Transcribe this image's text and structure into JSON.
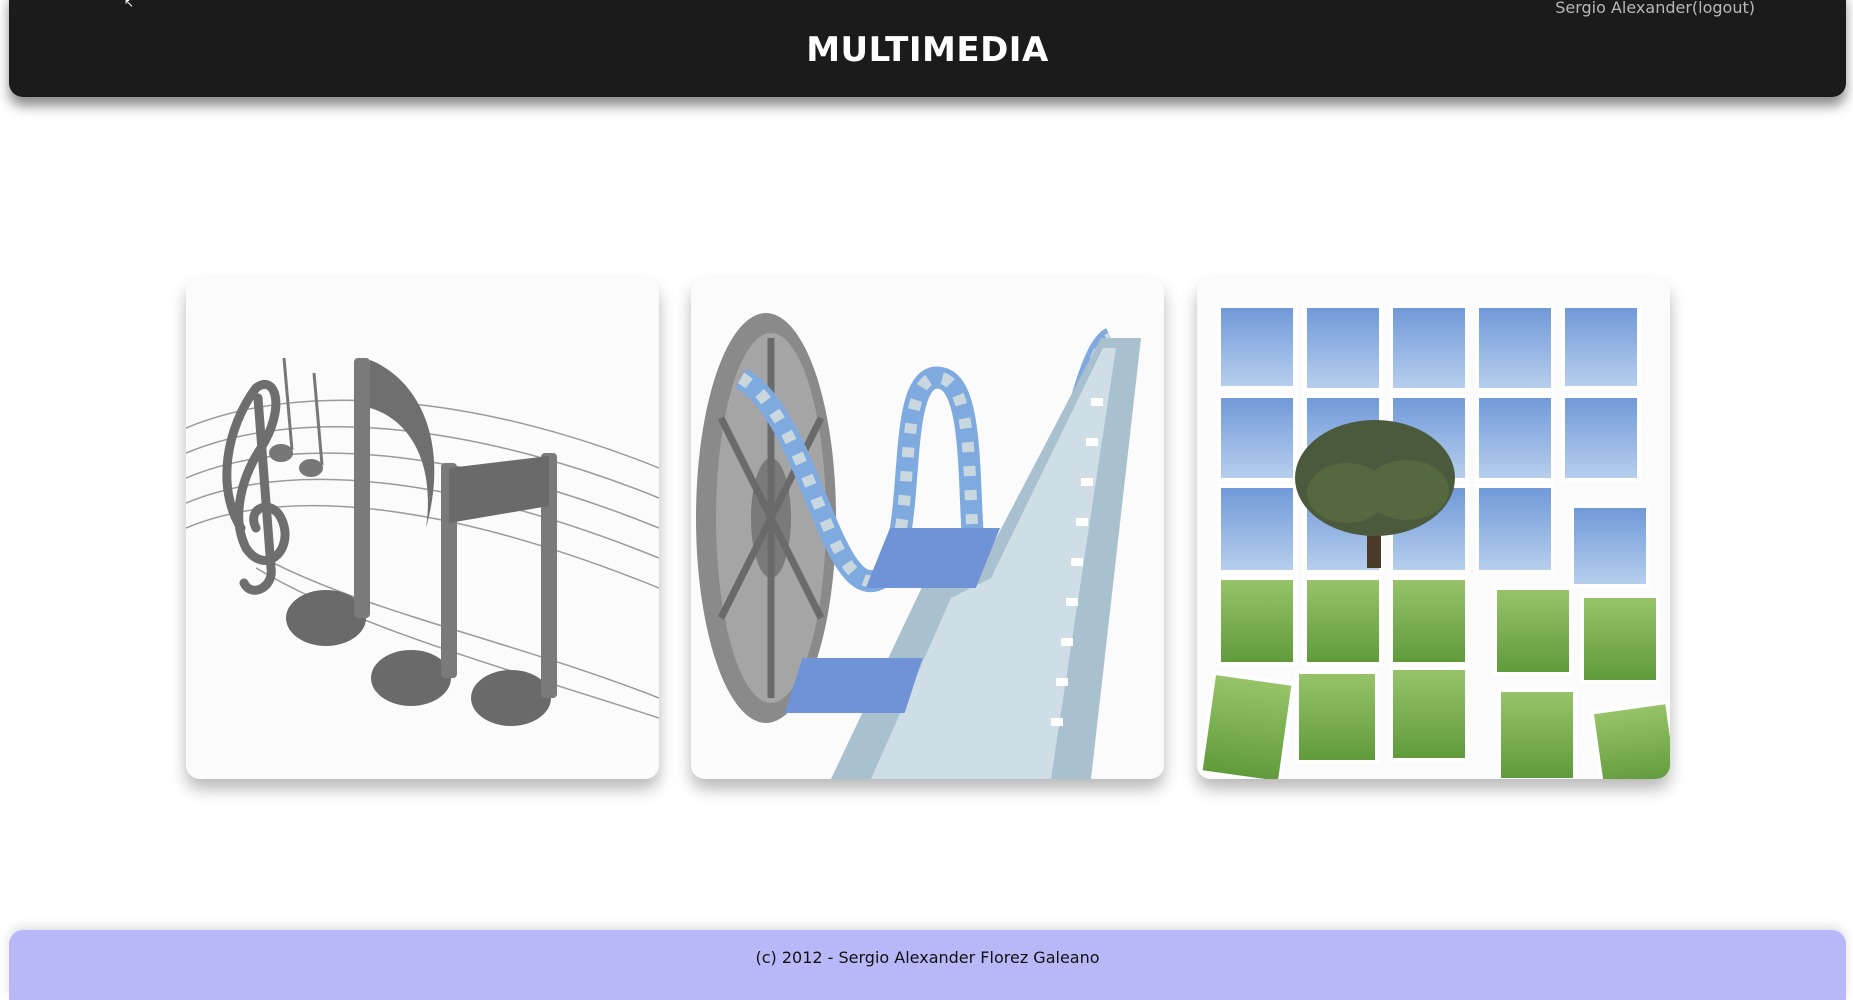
{
  "header": {
    "title": "MULTIMEDIA",
    "user_link": "Sergio Alexander(logout)"
  },
  "gallery": {
    "items": [
      {
        "name": "music",
        "icon": "music-notes-icon"
      },
      {
        "name": "video",
        "icon": "film-reel-icon"
      },
      {
        "name": "photos",
        "icon": "photo-mosaic-icon"
      }
    ]
  },
  "footer": {
    "copyright": "(c) 2012 - Sergio Alexander Florez Galeano"
  },
  "colors": {
    "header_bg": "#1b1b1b",
    "footer_bg": "#b8b8f8",
    "card_bg": "#fafafa"
  }
}
